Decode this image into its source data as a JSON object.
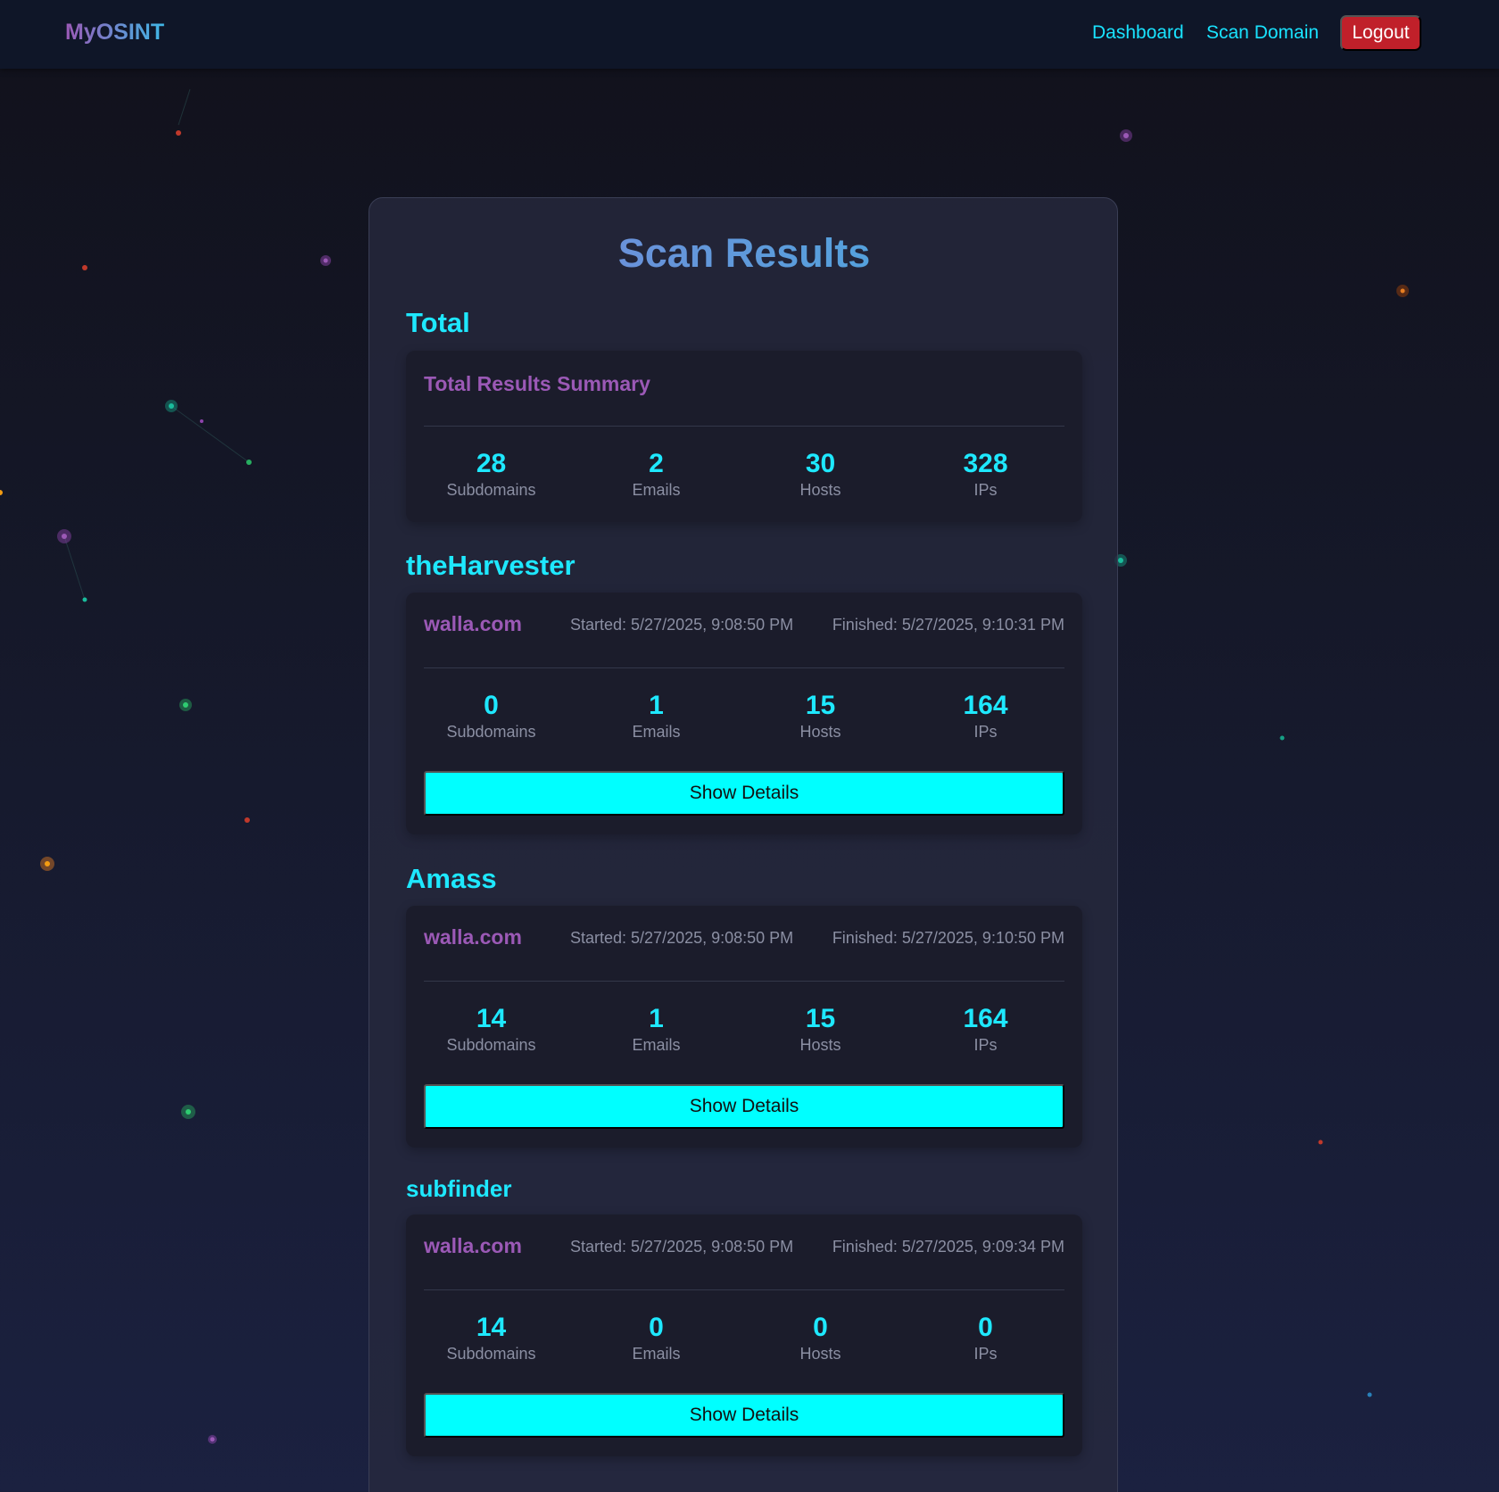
{
  "nav": {
    "brand": "MyOSINT",
    "links": [
      "Dashboard",
      "Scan Domain"
    ],
    "logout": "Logout"
  },
  "page_title": "Scan Results",
  "total": {
    "heading": "Total",
    "summary_title": "Total Results Summary",
    "stats": [
      {
        "value": "28",
        "label": "Subdomains"
      },
      {
        "value": "2",
        "label": "Emails"
      },
      {
        "value": "30",
        "label": "Hosts"
      },
      {
        "value": "328",
        "label": "IPs"
      }
    ]
  },
  "tools": [
    {
      "name": "theHarvester",
      "domain": "walla.com",
      "started": "Started: 5/27/2025, 9:08:50 PM",
      "finished": "Finished: 5/27/2025, 9:10:31 PM",
      "stats": [
        {
          "value": "0",
          "label": "Subdomains"
        },
        {
          "value": "1",
          "label": "Emails"
        },
        {
          "value": "15",
          "label": "Hosts"
        },
        {
          "value": "164",
          "label": "IPs"
        }
      ],
      "button": "Show Details"
    },
    {
      "name": "Amass",
      "domain": "walla.com",
      "started": "Started: 5/27/2025, 9:08:50 PM",
      "finished": "Finished: 5/27/2025, 9:10:50 PM",
      "stats": [
        {
          "value": "14",
          "label": "Subdomains"
        },
        {
          "value": "1",
          "label": "Emails"
        },
        {
          "value": "15",
          "label": "Hosts"
        },
        {
          "value": "164",
          "label": "IPs"
        }
      ],
      "button": "Show Details"
    },
    {
      "name": "subfinder",
      "domain": "walla.com",
      "started": "Started: 5/27/2025, 9:08:50 PM",
      "finished": "Finished: 5/27/2025, 9:09:34 PM",
      "stats": [
        {
          "value": "14",
          "label": "Subdomains"
        },
        {
          "value": "0",
          "label": "Emails"
        },
        {
          "value": "0",
          "label": "Hosts"
        },
        {
          "value": "0",
          "label": "IPs"
        }
      ],
      "button": "Show Details"
    }
  ],
  "colors": {
    "accent": "#1ee8ff",
    "domain": "#9b59b6",
    "logout": "#c0202a",
    "button": "#00ffff"
  }
}
